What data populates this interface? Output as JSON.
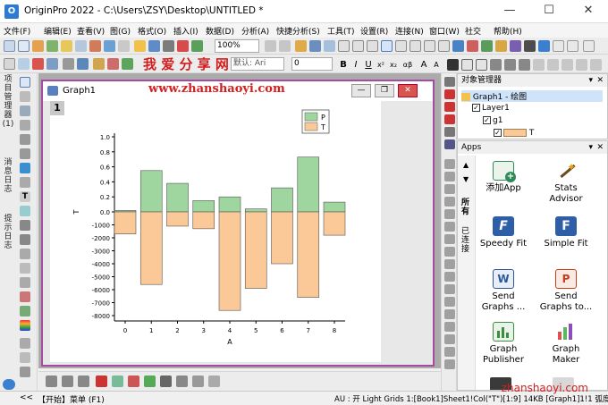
{
  "window": {
    "title": "OriginPro 2022 - C:\\Users\\ZSY\\Desktop\\UNTITLED *",
    "app_icon": "origin-logo"
  },
  "menu": [
    "文件(F)",
    "编辑(E)",
    "查看(V)",
    "图(G)",
    "格式(O)",
    "插入(I)",
    "数据(D)",
    "分析(A)",
    "快捷分析(S)",
    "工具(T)",
    "设置(R)",
    "连接(N)",
    "窗口(W)",
    "社交",
    "帮助(H)"
  ],
  "toolbar": {
    "zoom": "100%",
    "font_size": "0",
    "font_name": "默认: Ari"
  },
  "watermark_top": "我 爱 分 享 网",
  "watermark_url": "www.zhanshaoyi.com",
  "left_tabs": [
    "项目管理器",
    "(1)",
    "消息日志",
    "提示日志"
  ],
  "graph": {
    "title": "Graph1",
    "layer_number": "1",
    "chart_data": {
      "type": "bar",
      "x": [
        0,
        1,
        2,
        3,
        4,
        5,
        6,
        7,
        8
      ],
      "xlabel": "A",
      "ylabel": "T",
      "series": [
        {
          "name": "P",
          "values": [
            0.02,
            0.55,
            0.38,
            0.15,
            0.2,
            0.04,
            0.32,
            0.73,
            0.13
          ]
        },
        {
          "name": "T",
          "values": [
            -1700,
            -5600,
            -1100,
            -1300,
            -7600,
            -5900,
            -4000,
            -6600,
            -1800
          ]
        }
      ],
      "upper_ticks": [
        "1.0",
        "0.8",
        "0.6",
        "0.4",
        "0.2",
        "0.0"
      ],
      "lower_ticks": [
        "-1000",
        "-2000",
        "-3000",
        "-4000",
        "-5000",
        "-6000",
        "-7000",
        "-8000"
      ],
      "x_ticks": [
        "0",
        "1",
        "2",
        "3",
        "4",
        "5",
        "6",
        "7",
        "8"
      ],
      "colors": {
        "P": "#9fd69f",
        "T": "#fbc898"
      },
      "legend_position": "top-right"
    }
  },
  "object_manager": {
    "title": "对象管理器",
    "items": [
      {
        "label": "Graph1 - 绘图"
      },
      {
        "label": "Layer1"
      },
      {
        "label": "g1"
      },
      {
        "label": "T"
      }
    ]
  },
  "apps": {
    "title": "Apps",
    "side_tabs": [
      "所有",
      "已连接"
    ],
    "items": [
      {
        "label": "添加App",
        "icon": "add-app-icon",
        "color": "#2e8b57"
      },
      {
        "label": "Stats Advisor",
        "icon": "magic-wand-icon",
        "color": "#c98a1f"
      },
      {
        "label": "Speedy Fit",
        "icon": "speedy-fit-icon",
        "color": "#2f5ea8"
      },
      {
        "label": "Simple Fit",
        "icon": "simple-fit-icon",
        "color": "#2f5ea8"
      },
      {
        "label": "Send Graphs ...",
        "icon": "word-icon",
        "color": "#2b579a"
      },
      {
        "label": "Send Graphs to...",
        "icon": "powerpoint-icon",
        "color": "#c43e1c"
      },
      {
        "label": "Graph Publisher",
        "icon": "graph-publisher-icon",
        "color": "#3c8f3c"
      },
      {
        "label": "Graph Maker",
        "icon": "graph-maker-icon",
        "color": "#8a4fb8"
      }
    ]
  },
  "bottom_bar": {
    "label": "【开始】菜单 (F1)"
  },
  "status": {
    "text": "AU : 开  Light Grids  1:[Book1]Sheet1!Col(\"T\")[1:9]  14KB  [Graph1]1!1 弧度",
    "watermark": "zhanshaoyi.com"
  }
}
